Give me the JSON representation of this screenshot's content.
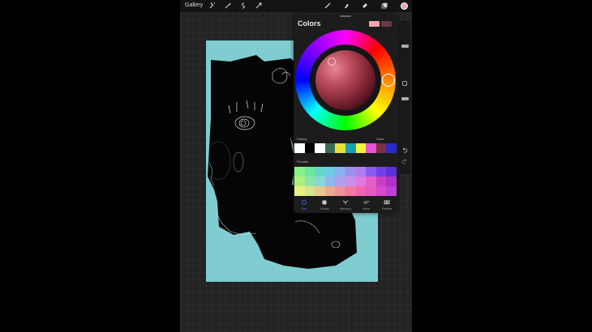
{
  "topbar": {
    "gallery_label": "Gallery",
    "left_icons": [
      "wrench-icon",
      "magic-wand-icon",
      "selection-icon",
      "transform-icon"
    ],
    "right_icons": [
      "brush-icon",
      "smudge-icon",
      "eraser-icon",
      "layers-icon"
    ],
    "current_color": "#f0a0b0"
  },
  "colors_panel": {
    "title": "Colors",
    "primary_swatch": "#f2a3b2",
    "secondary_swatch": "#6b3a42",
    "history_label": "History",
    "clear_label": "Clear",
    "history": [
      "#ffffff",
      "#000000",
      "#ffffff",
      "#3a6a58",
      "#e6e23a",
      "#1aa0b0",
      "#f4f43a",
      "#e454d0",
      "#7a3040",
      "#2a2ac8"
    ],
    "palette_label": "Flourish",
    "palette": [
      [
        "#8af08a",
        "#6ae8a0",
        "#64d8c8",
        "#70c8e8",
        "#8ab0f0",
        "#9a90f0",
        "#b07cf0",
        "#8a5af0",
        "#7040e8",
        "#5a30d8"
      ],
      [
        "#b0f080",
        "#8ae6a8",
        "#88d8d8",
        "#90b8ec",
        "#b0a0ec",
        "#c890e8",
        "#e07ae0",
        "#e460c8",
        "#c840c0",
        "#b030c8"
      ],
      [
        "#e8f080",
        "#d8e48a",
        "#e8c890",
        "#f0a890",
        "#f09098",
        "#f07aa0",
        "#f064b0",
        "#e858c0",
        "#d848d0",
        "#c040d8"
      ]
    ],
    "tabs": [
      {
        "label": "Disc",
        "icon": "disc-icon",
        "active": true
      },
      {
        "label": "Classic",
        "icon": "classic-icon",
        "active": false
      },
      {
        "label": "Harmony",
        "icon": "harmony-icon",
        "active": false
      },
      {
        "label": "Value",
        "icon": "value-icon",
        "active": false
      },
      {
        "label": "Palettes",
        "icon": "palettes-icon",
        "active": false
      }
    ]
  },
  "sidebar": {
    "icons": [
      "modify-button-icon",
      "undo-icon",
      "redo-icon"
    ]
  }
}
